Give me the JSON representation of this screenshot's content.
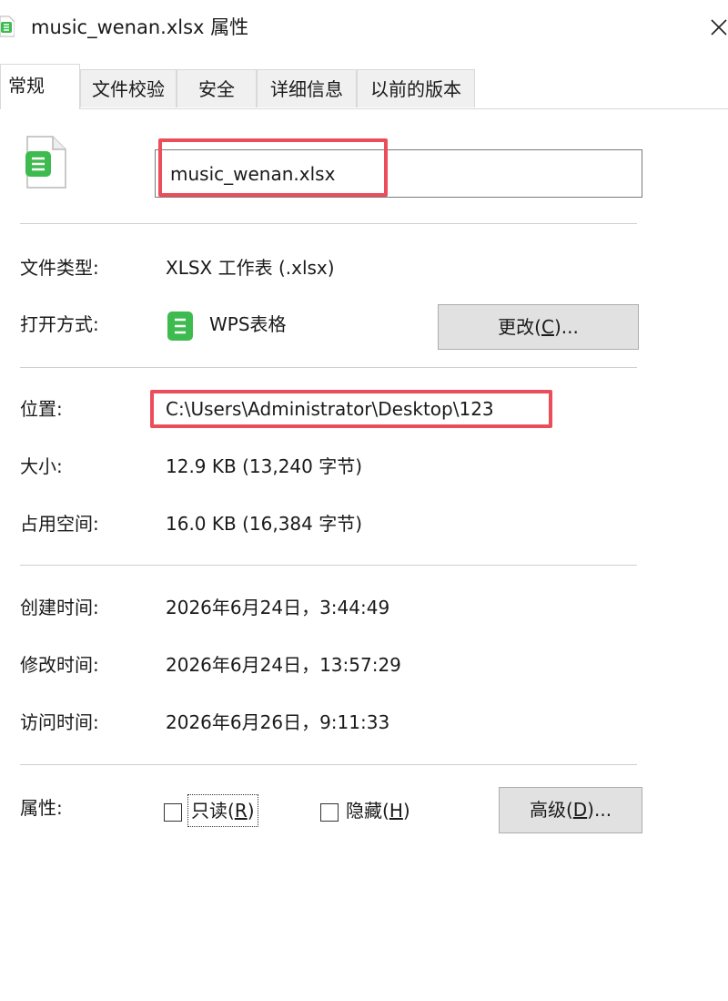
{
  "window": {
    "title": "music_wenan.xlsx 属性",
    "close_glyph": "✕"
  },
  "tabs": [
    {
      "label": "常规",
      "active": true
    },
    {
      "label": "文件校验",
      "active": false
    },
    {
      "label": "安全",
      "active": false
    },
    {
      "label": "详细信息",
      "active": false
    },
    {
      "label": "以前的版本",
      "active": false
    }
  ],
  "general": {
    "file_name": "music_wenan.xlsx",
    "file_icon": "wps-spreadsheet-icon",
    "file_type_label": "文件类型:",
    "file_type_value": "XLSX 工作表 (.xlsx)",
    "opens_with_label": "打开方式:",
    "opens_with_value": "WPS表格",
    "change_button": {
      "label_pre": "更改(",
      "accel": "C",
      "label_post": ")..."
    },
    "location_label": "位置:",
    "location_value": "C:\\Users\\Administrator\\Desktop\\123",
    "size_label": "大小:",
    "size_value": "12.9 KB (13,240 字节)",
    "size_on_disk_label": "占用空间:",
    "size_on_disk_value": "16.0 KB (16,384 字节)",
    "created_label": "创建时间:",
    "created_value": "2026年6月24日，3:44:49",
    "modified_label": "修改时间:",
    "modified_value": "2026年6月24日，13:57:29",
    "accessed_label": "访问时间:",
    "accessed_value": "2026年6月26日，9:11:33",
    "attributes_label": "属性:",
    "readonly": {
      "label_pre": "只读(",
      "accel": "R",
      "label_post": ")",
      "checked": false
    },
    "hidden": {
      "label_pre": "隐藏(",
      "accel": "H",
      "label_post": ")",
      "checked": false
    },
    "advanced_button": {
      "label_pre": "高级(",
      "accel": "D",
      "label_post": ")..."
    }
  },
  "colors": {
    "highlight_box": "#ec4d5b",
    "wps_green": "#3dbb4e"
  }
}
